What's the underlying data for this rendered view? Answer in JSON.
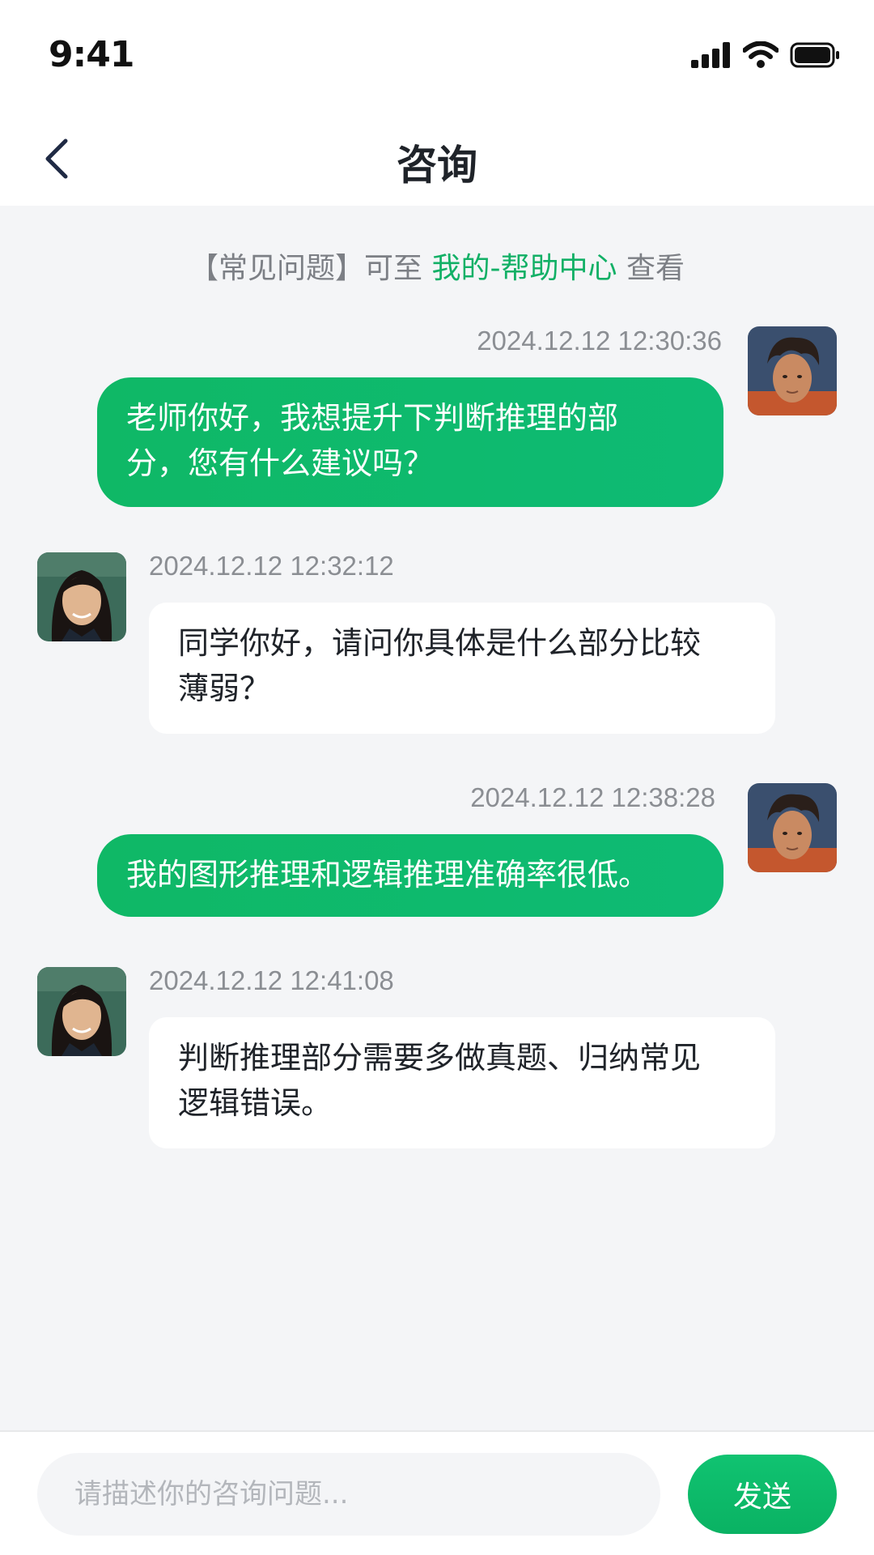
{
  "status_bar": {
    "time": "9:41"
  },
  "nav": {
    "title": "咨询"
  },
  "notice": {
    "prefix": "【常见问题】可至",
    "link": "我的-帮助中心",
    "suffix": "查看"
  },
  "messages": [
    {
      "sender": "user",
      "time": "2024.12.12 12:30:36",
      "line1": "老师你好，我想提升下判断推理的部",
      "line2": "分，您有什么建议吗？"
    },
    {
      "sender": "teacher",
      "time": "2024.12.12 12:32:12",
      "line1": "同学你好，请问你具体是什么部分比较",
      "line2": "薄弱？"
    },
    {
      "sender": "user",
      "time": "2024.12.12 12:38:28",
      "line1": "我的图形推理和逻辑推理准确率很低。"
    },
    {
      "sender": "teacher",
      "time": "2024.12.12 12:41:08",
      "line1": "判断推理部分需要多做真题、归纳常见",
      "line2": "逻辑错误。"
    }
  ],
  "composer": {
    "placeholder": "请描述你的咨询问题...",
    "send_label": "发送"
  },
  "colors": {
    "accent": "#12b066",
    "chat_bg": "#f4f5f7",
    "bubble_sent": "#0fb866",
    "bubble_recv": "#ffffff"
  },
  "icons": [
    "cellular-signal-icon",
    "wifi-icon",
    "battery-icon",
    "back-arrow-icon"
  ]
}
